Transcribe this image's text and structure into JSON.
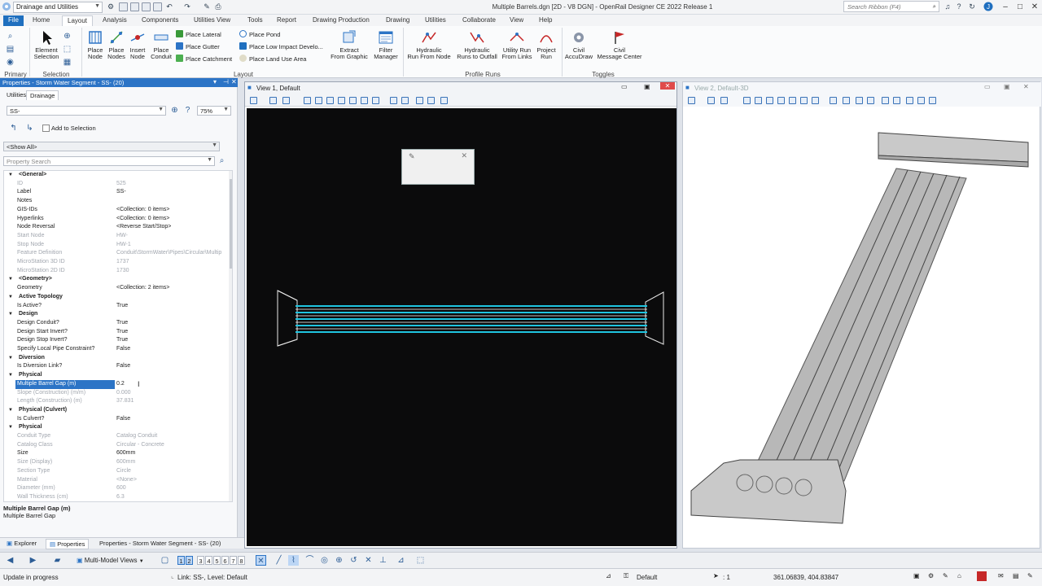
{
  "title_bar": {
    "workflow": "Drainage and Utilities",
    "document_title": "Multiple Barrels.dgn [2D - V8 DGN] - OpenRail Designer CE 2022 Release 1",
    "search_placeholder": "Search Ribbon (F4)"
  },
  "menu": {
    "items": [
      "File",
      "Home",
      "Layout",
      "Analysis",
      "Components",
      "Utilities View",
      "Tools",
      "Report",
      "Drawing Production",
      "Drawing",
      "Utilities",
      "Collaborate",
      "View",
      "Help"
    ],
    "active": "Layout"
  },
  "ribbon": {
    "groups": {
      "primary": "Primary",
      "selection": "Selection",
      "layout": "Layout",
      "profile_runs": "Profile Runs",
      "toggles": "Toggles"
    },
    "element_selection": "Element\nSelection",
    "place_node": "Place\nNode",
    "place_nodes": "Place\nNodes",
    "insert_node": "Insert\nNode",
    "place_conduit": "Place\nConduit",
    "place_lateral": "Place Lateral",
    "place_gutter": "Place Gutter",
    "place_catchment": "Place Catchment",
    "place_pond": "Place Pond",
    "place_low_impact": "Place Low Impact Develo...",
    "place_land_use": "Place Land Use Area",
    "extract_from_graphic": "Extract\nFrom Graphic",
    "filter_manager": "Filter\nManager",
    "hydraulic_run_from_node": "Hydraulic\nRun From Node",
    "hydraulic_runs_to_outfall": "Hydraulic\nRuns to Outfall",
    "utility_run_from_links": "Utility Run\nFrom Links",
    "project_run": "Project\nRun",
    "civil_accudraw": "Civil\nAccuDraw",
    "civil_message_center": "Civil\nMessage Center"
  },
  "properties": {
    "panel_title": "Properties - Storm Water Segment - SS- (20)",
    "tabs": [
      "Utilities",
      "Drainage"
    ],
    "element_select": "SS-",
    "zoom": "75%",
    "add_to_selection": "Add to Selection",
    "filter": "<Show All>",
    "search_placeholder": "Property Search",
    "rows": [
      {
        "type": "cat",
        "name": "<General>"
      },
      {
        "type": "dim",
        "name": "ID",
        "value": "525"
      },
      {
        "type": "prop",
        "name": "Label",
        "value": "SS-"
      },
      {
        "type": "prop",
        "name": "Notes",
        "value": ""
      },
      {
        "type": "prop",
        "name": "GIS-IDs",
        "value": "<Collection: 0 items>"
      },
      {
        "type": "prop",
        "name": "Hyperlinks",
        "value": "<Collection: 0 items>"
      },
      {
        "type": "prop",
        "name": "Node Reversal",
        "value": "<Reverse Start/Stop>"
      },
      {
        "type": "dim",
        "name": "Start Node",
        "value": "HW-"
      },
      {
        "type": "dim",
        "name": "Stop Node",
        "value": "HW-1"
      },
      {
        "type": "dim",
        "name": "Feature Definition",
        "value": "Conduit\\StormWater\\Pipes\\Circular\\Multip"
      },
      {
        "type": "dim",
        "name": "MicroStation 3D ID",
        "value": "1737"
      },
      {
        "type": "dim",
        "name": "MicroStation 2D ID",
        "value": "1730"
      },
      {
        "type": "cat",
        "name": "<Geometry>"
      },
      {
        "type": "prop",
        "name": "Geometry",
        "value": "<Collection: 2 items>"
      },
      {
        "type": "cat",
        "name": "Active Topology"
      },
      {
        "type": "prop",
        "name": "Is Active?",
        "value": "True"
      },
      {
        "type": "cat",
        "name": "Design"
      },
      {
        "type": "prop",
        "name": "Design Conduit?",
        "value": "True"
      },
      {
        "type": "prop",
        "name": "Design Start Invert?",
        "value": "True"
      },
      {
        "type": "prop",
        "name": "Design Stop Invert?",
        "value": "True"
      },
      {
        "type": "prop",
        "name": "Specify Local Pipe Constraint?",
        "value": "False"
      },
      {
        "type": "cat",
        "name": "Diversion"
      },
      {
        "type": "prop",
        "name": "Is Diversion Link?",
        "value": "False"
      },
      {
        "type": "cat",
        "name": "Physical"
      },
      {
        "type": "sel",
        "name": "Multiple Barrel Gap (m)",
        "value": "0.2"
      },
      {
        "type": "dim",
        "name": "Slope (Construction) (m/m)",
        "value": "0.000"
      },
      {
        "type": "dim",
        "name": "Length (Construction) (m)",
        "value": "37.831"
      },
      {
        "type": "cat",
        "name": "Physical (Culvert)"
      },
      {
        "type": "prop",
        "name": "Is Culvert?",
        "value": "False"
      },
      {
        "type": "cat",
        "name": "Physical"
      },
      {
        "type": "dim",
        "name": "Conduit Type",
        "value": "Catalog Conduit"
      },
      {
        "type": "dim",
        "name": "Catalog Class",
        "value": "Circular - Concrete"
      },
      {
        "type": "prop",
        "name": "Size",
        "value": "600mm"
      },
      {
        "type": "dim",
        "name": "Size (Display)",
        "value": "600mm"
      },
      {
        "type": "dim",
        "name": "Section Type",
        "value": "Circle"
      },
      {
        "type": "dim",
        "name": "Material",
        "value": "<None>"
      },
      {
        "type": "dim",
        "name": "Diameter (mm)",
        "value": "600"
      },
      {
        "type": "dim",
        "name": "Wall Thickness (cm)",
        "value": "6.3"
      }
    ],
    "description_title": "Multiple Barrel Gap (m)",
    "description_text": "Multiple Barrel Gap"
  },
  "bottom_tabs": [
    "Explorer",
    "Properties",
    "Properties - Storm Water Segment - SS- (20)"
  ],
  "view1": {
    "title": "View 1, Default"
  },
  "view2": {
    "title": "View 2, Default-3D"
  },
  "bottom_toolbar": {
    "multi_model_views": "Multi-Model Views",
    "view_numbers": [
      "1",
      "2",
      "3",
      "4",
      "5",
      "6",
      "7",
      "8"
    ]
  },
  "status": {
    "left": "Update in progress",
    "link": "Link: SS-, Level: Default",
    "level": "Default",
    "selection_count": ": 1",
    "coordinates": "361.06839, 404.83847"
  },
  "colors": {
    "accent": "#2c74c6",
    "pipe": "#20c4e0",
    "canvas": "#0b0b0c"
  }
}
